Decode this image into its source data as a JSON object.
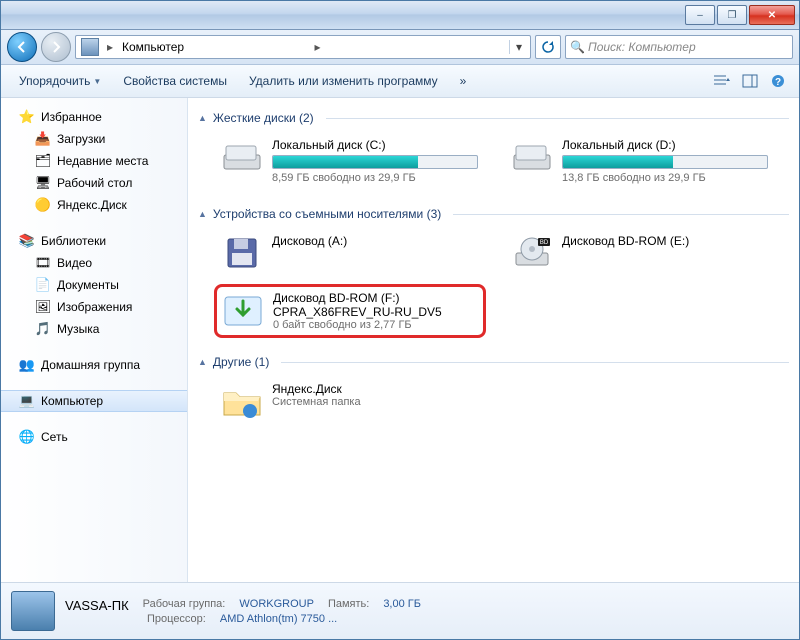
{
  "titlebar": {
    "min": "–",
    "max": "❐",
    "close": "✕"
  },
  "nav": {
    "breadcrumb_root": "Компьютер",
    "search_placeholder": "Поиск: Компьютер"
  },
  "toolbar": {
    "organize": "Упорядочить",
    "sysprops": "Свойства системы",
    "uninstall": "Удалить или изменить программу",
    "more": "»"
  },
  "sidebar": {
    "fav_head": "Избранное",
    "fav": [
      {
        "label": "Загрузки"
      },
      {
        "label": "Недавние места"
      },
      {
        "label": "Рабочий стол"
      },
      {
        "label": "Яндекс.Диск"
      }
    ],
    "lib_head": "Библиотеки",
    "lib": [
      {
        "label": "Видео"
      },
      {
        "label": "Документы"
      },
      {
        "label": "Изображения"
      },
      {
        "label": "Музыка"
      }
    ],
    "homegroup": "Домашняя группа",
    "computer": "Компьютер",
    "network": "Сеть"
  },
  "content": {
    "hdd_head": "Жесткие диски (2)",
    "hdd": [
      {
        "name": "Локальный диск (C:)",
        "sub": "8,59 ГБ свободно из 29,9 ГБ",
        "fill": 71
      },
      {
        "name": "Локальный диск (D:)",
        "sub": "13,8 ГБ свободно из 29,9 ГБ",
        "fill": 54
      }
    ],
    "rem_head": "Устройства со съемными носителями (3)",
    "rem": [
      {
        "name": "Дисковод (A:)",
        "sub": ""
      },
      {
        "name": "Дисковод BD-ROM (E:)",
        "sub": ""
      },
      {
        "name": "Дисковод BD-ROM (F:)",
        "name2": "CPRA_X86FREV_RU-RU_DV5",
        "sub": "0 байт свободно из 2,77 ГБ",
        "hl": true
      }
    ],
    "other_head": "Другие (1)",
    "other": [
      {
        "name": "Яндекс.Диск",
        "sub": "Системная папка"
      }
    ]
  },
  "status": {
    "pc": "VASSA-ПК",
    "wg_lbl": "Рабочая группа:",
    "wg": "WORKGROUP",
    "mem_lbl": "Память:",
    "mem": "3,00 ГБ",
    "cpu_lbl": "Процессор:",
    "cpu": "AMD Athlon(tm) 7750 ..."
  }
}
